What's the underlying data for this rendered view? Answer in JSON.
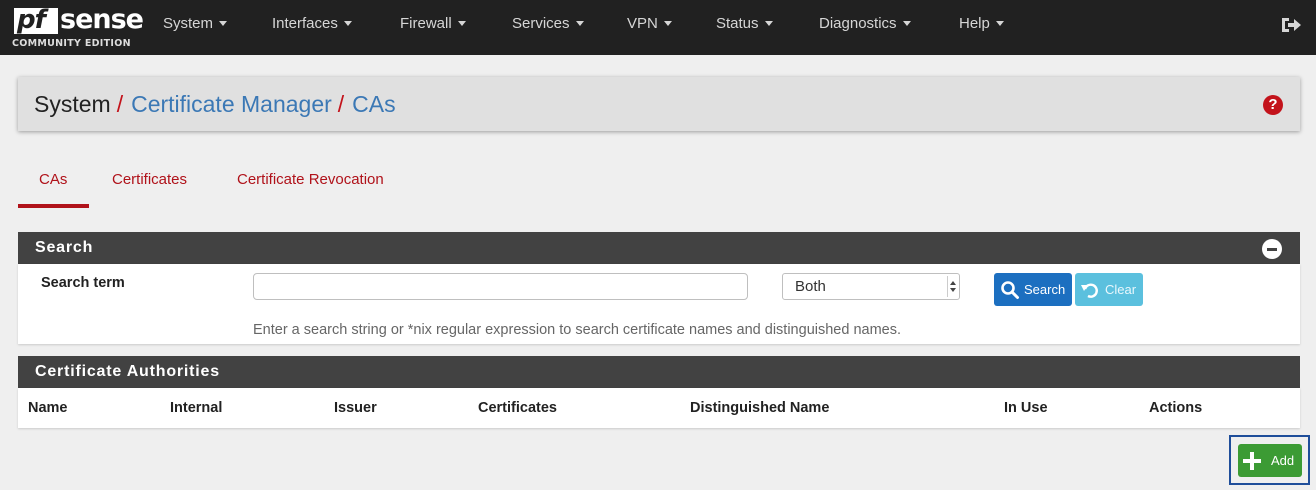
{
  "brand": {
    "logo_pf": "pf",
    "logo_sense": "sense",
    "edition": "COMMUNITY EDITION"
  },
  "nav": {
    "items": [
      {
        "label": "System"
      },
      {
        "label": "Interfaces"
      },
      {
        "label": "Firewall"
      },
      {
        "label": "Services"
      },
      {
        "label": "VPN"
      },
      {
        "label": "Status"
      },
      {
        "label": "Diagnostics"
      },
      {
        "label": "Help"
      }
    ],
    "logout_icon": "logout-icon"
  },
  "breadcrumb": {
    "root": "System",
    "separator": "/",
    "section": "Certificate Manager",
    "page": "CAs",
    "help_glyph": "?"
  },
  "tabs": [
    {
      "label": "CAs",
      "active": true
    },
    {
      "label": "Certificates",
      "active": false
    },
    {
      "label": "Certificate Revocation",
      "active": false
    }
  ],
  "search": {
    "panel_title": "Search",
    "term_label": "Search term",
    "term_value": "",
    "scope_selected": "Both",
    "search_button": "Search",
    "clear_button": "Clear",
    "help_text": "Enter a search string or *nix regular expression to search certificate names and distinguished names."
  },
  "table": {
    "panel_title": "Certificate Authorities",
    "columns": [
      "Name",
      "Internal",
      "Issuer",
      "Certificates",
      "Distinguished Name",
      "In Use",
      "Actions"
    ],
    "rows": []
  },
  "add_button": {
    "label": "Add"
  },
  "colors": {
    "navbar": "#212121",
    "link_red": "#b0121a",
    "link_blue": "#3b78b5",
    "primary": "#1c6fc0",
    "info": "#5bc0de",
    "success": "#3c9b34",
    "panel_head": "#424242"
  }
}
